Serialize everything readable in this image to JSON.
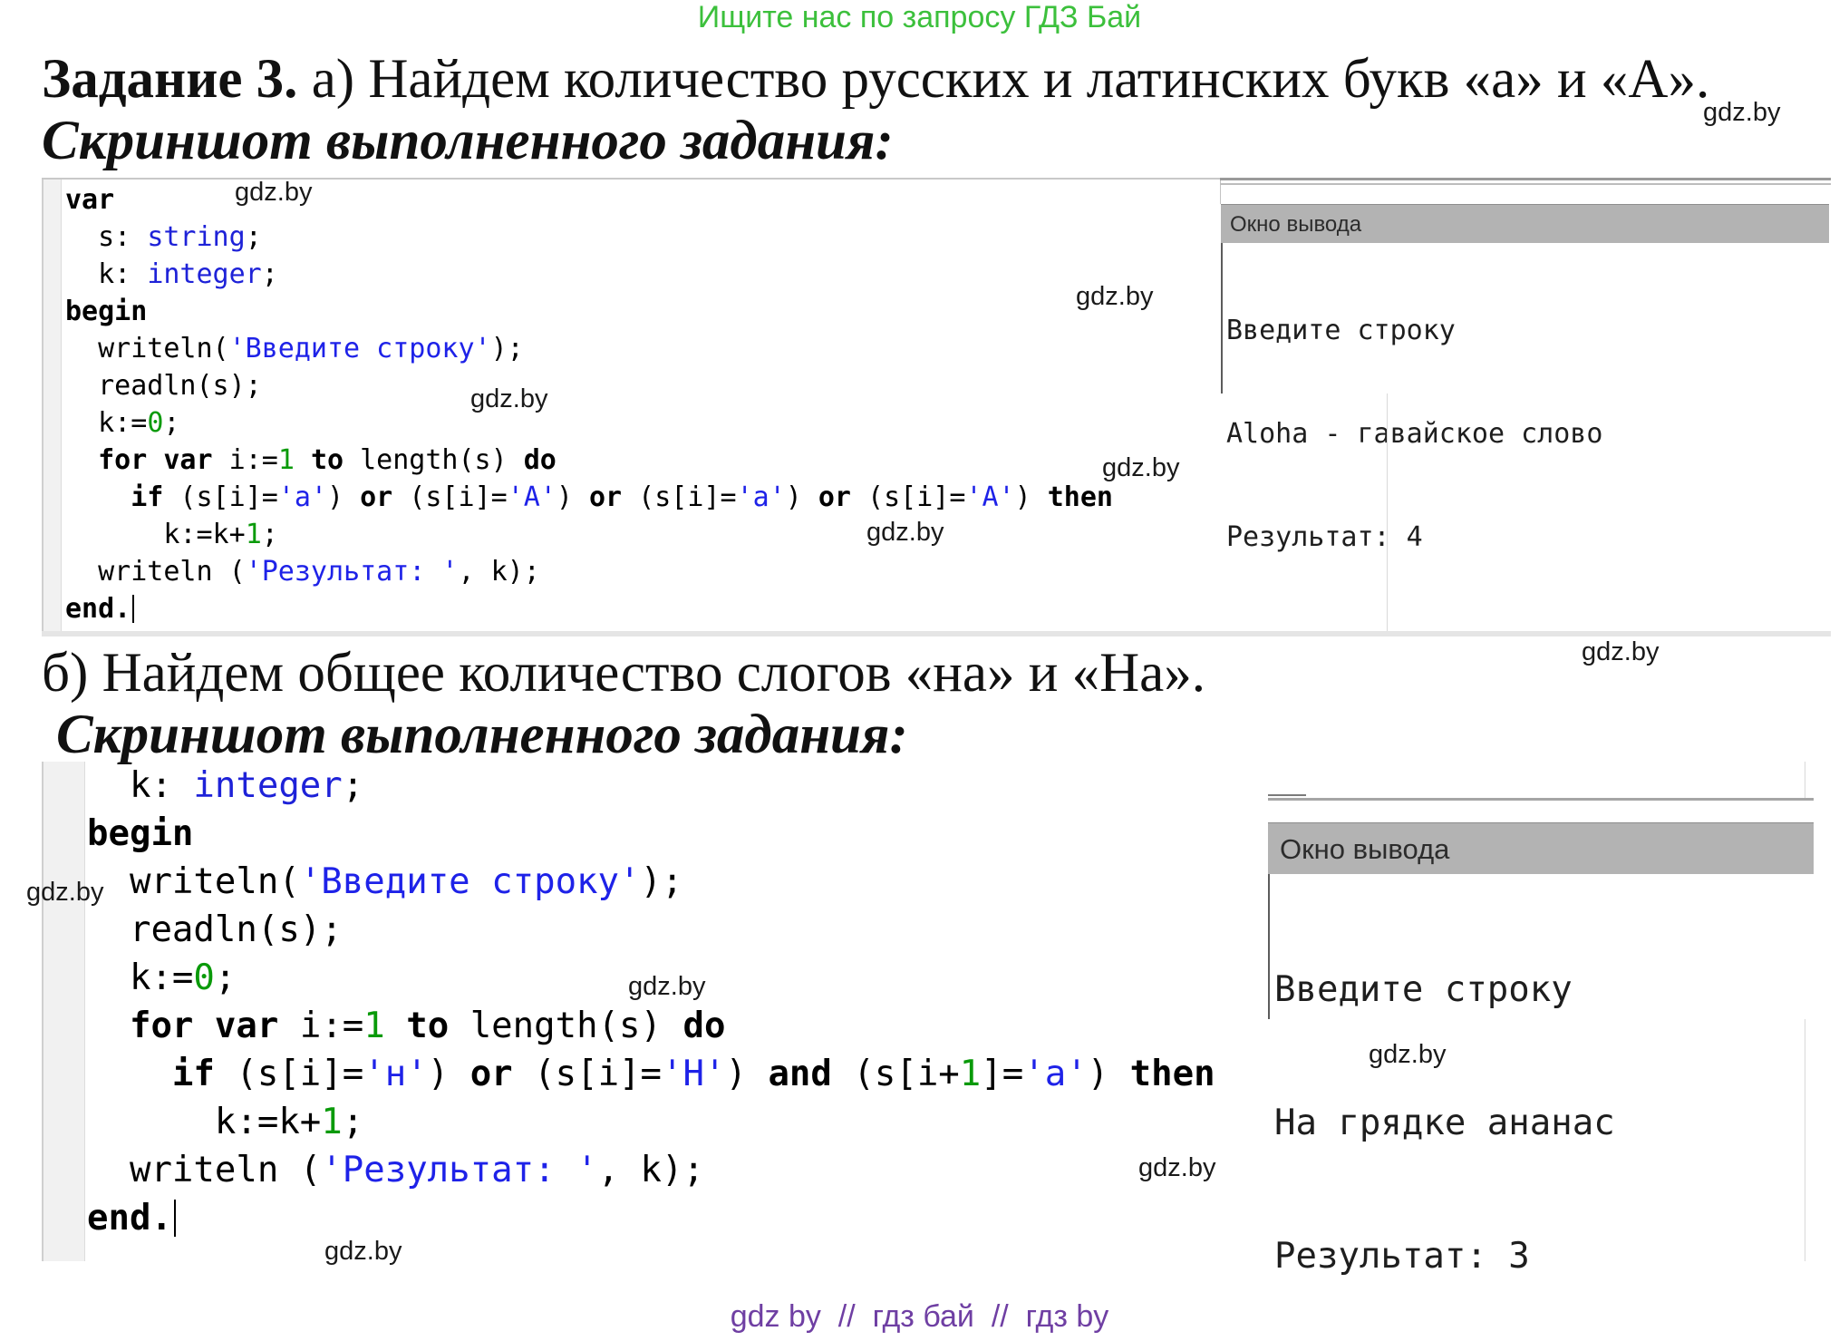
{
  "header_link": "Ищите нас по запросу ГДЗ Бай",
  "watermark": "gdz.by",
  "task_a": {
    "label": "Задание 3.",
    "text": "а) Найдем количество русских и латинских букв «а» и «А».",
    "caption": "Скриншот выполненного задания:",
    "editor": {
      "lines": [
        [
          {
            "k": "var"
          }
        ],
        [
          {
            "t": "  s: "
          },
          {
            "y": "string"
          },
          {
            "t": ";"
          }
        ],
        [
          {
            "t": "  k: "
          },
          {
            "y": "integer"
          },
          {
            "t": ";"
          }
        ],
        [
          {
            "k": "begin"
          }
        ],
        [
          {
            "t": "  writeln("
          },
          {
            "s": "'Введите строку'"
          },
          {
            "t": ");"
          }
        ],
        [
          {
            "t": "  readln(s);"
          }
        ],
        [
          {
            "t": "  k:="
          },
          {
            "n": "0"
          },
          {
            "t": ";"
          }
        ],
        [
          {
            "t": "  "
          },
          {
            "k": "for"
          },
          {
            "t": " "
          },
          {
            "k": "var"
          },
          {
            "t": " i:="
          },
          {
            "n": "1"
          },
          {
            "t": " "
          },
          {
            "k": "to"
          },
          {
            "t": " length(s) "
          },
          {
            "k": "do"
          }
        ],
        [
          {
            "t": "    "
          },
          {
            "k": "if"
          },
          {
            "t": " (s[i]="
          },
          {
            "s": "'a'"
          },
          {
            "t": ") "
          },
          {
            "k": "or"
          },
          {
            "t": " (s[i]="
          },
          {
            "s": "'A'"
          },
          {
            "t": ") "
          },
          {
            "k": "or"
          },
          {
            "t": " (s[i]="
          },
          {
            "s": "'а'"
          },
          {
            "t": ") "
          },
          {
            "k": "or"
          },
          {
            "t": " (s[i]="
          },
          {
            "s": "'А'"
          },
          {
            "t": ") "
          },
          {
            "k": "then"
          }
        ],
        [
          {
            "t": "      k:=k+"
          },
          {
            "n": "1"
          },
          {
            "t": ";"
          }
        ],
        [
          {
            "t": "  writeln ("
          },
          {
            "s": "'Результат: '"
          },
          {
            "t": ", k);"
          }
        ],
        [
          {
            "k": "end."
          }
        ]
      ]
    },
    "output": {
      "title": "Окно вывода",
      "lines": [
        "Введите строку",
        "Aloha - гавайское слово",
        "Результат: 4"
      ]
    }
  },
  "task_b": {
    "text": "б) Найдем общее количество слогов «на» и «На».",
    "caption": "Скриншот выполненного задания:",
    "editor": {
      "lines": [
        [
          {
            "t": "  k: "
          },
          {
            "y": "integer"
          },
          {
            "t": ";"
          }
        ],
        [
          {
            "k": "begin"
          }
        ],
        [
          {
            "t": "  writeln("
          },
          {
            "s": "'Введите строку'"
          },
          {
            "t": ");"
          }
        ],
        [
          {
            "t": "  readln(s);"
          }
        ],
        [
          {
            "t": "  k:="
          },
          {
            "n": "0"
          },
          {
            "t": ";"
          }
        ],
        [
          {
            "t": "  "
          },
          {
            "k": "for"
          },
          {
            "t": " "
          },
          {
            "k": "var"
          },
          {
            "t": " i:="
          },
          {
            "n": "1"
          },
          {
            "t": " "
          },
          {
            "k": "to"
          },
          {
            "t": " length(s) "
          },
          {
            "k": "do"
          }
        ],
        [
          {
            "t": "    "
          },
          {
            "k": "if"
          },
          {
            "t": " (s[i]="
          },
          {
            "s": "'н'"
          },
          {
            "t": ") "
          },
          {
            "k": "or"
          },
          {
            "t": " (s[i]="
          },
          {
            "s": "'Н'"
          },
          {
            "t": ") "
          },
          {
            "k": "and"
          },
          {
            "t": " (s[i+"
          },
          {
            "n": "1"
          },
          {
            "t": "]="
          },
          {
            "s": "'а'"
          },
          {
            "t": ") "
          },
          {
            "k": "then"
          }
        ],
        [
          {
            "t": "      k:=k+"
          },
          {
            "n": "1"
          },
          {
            "t": ";"
          }
        ],
        [
          {
            "t": "  writeln ("
          },
          {
            "s": "'Результат: '"
          },
          {
            "t": ", k);"
          }
        ],
        [
          {
            "k": "end."
          }
        ]
      ]
    },
    "output": {
      "title": "Окно вывода",
      "lines": [
        "Введите строку",
        "На грядке ананас",
        "Результат: 3"
      ]
    }
  },
  "footer": "gdz by  //  гдз бай  //  гдз by",
  "colors": {
    "header_link": "#3cc03c",
    "footer": "#6f3fa3",
    "keyword": "#000000",
    "type": "#1e22d8",
    "string": "#1e22e8",
    "number": "#0a9a0a",
    "text": "#000000",
    "output_title_bar": "#b3b3b3"
  }
}
